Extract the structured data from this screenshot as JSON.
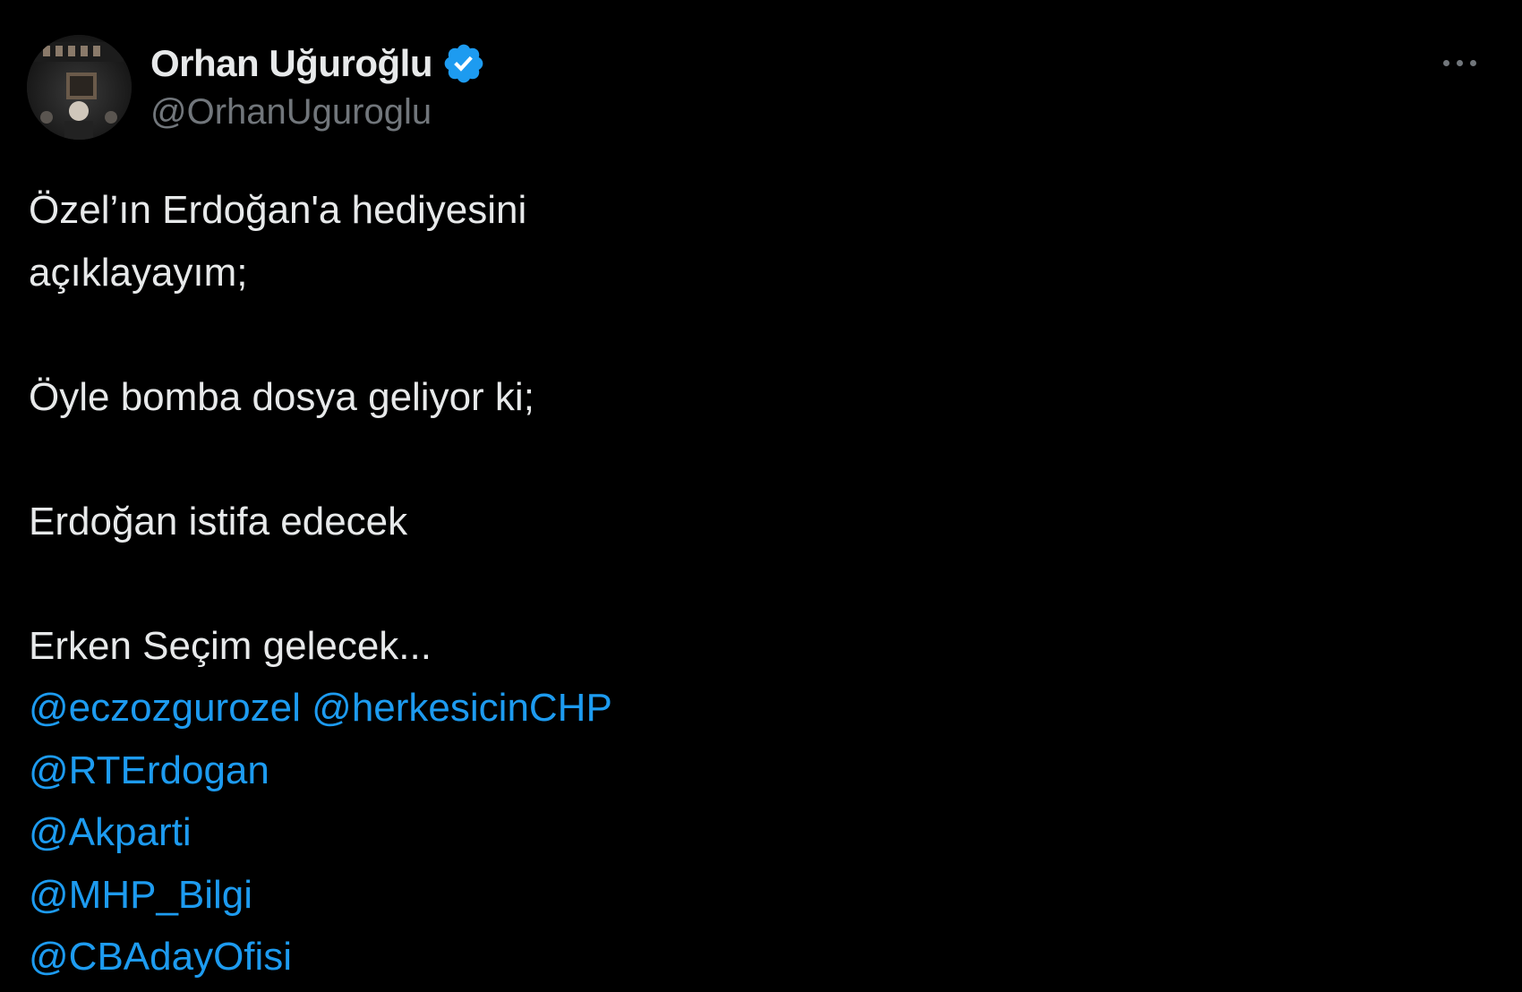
{
  "author": {
    "display_name": "Orhan Uğuroğlu",
    "handle": "@OrhanUguroglu",
    "avatar_icon": "profile-photo",
    "verified_icon": "verified-badge-icon",
    "verified_color": "#1d9bf0"
  },
  "menu": {
    "more_icon": "more-horizontal-icon"
  },
  "tweet": {
    "text_lines": [
      "Özel’ın Erdoğan'a hediyesini",
      "açıklayayım;",
      "",
      "Öyle bomba dosya geliyor ki;",
      "",
      "Erdoğan istifa edecek",
      "",
      "Erken Seçim gelecek..."
    ],
    "mentions": [
      "@eczozgurozel",
      "@herkesicinCHP",
      "@RTErdogan",
      "@Akparti",
      "@MHP_Bilgi",
      "@CBAdayOfisi"
    ]
  },
  "colors": {
    "background": "#000000",
    "text": "#e7e9ea",
    "secondary_text": "#71767b",
    "link": "#1d9bf0"
  }
}
